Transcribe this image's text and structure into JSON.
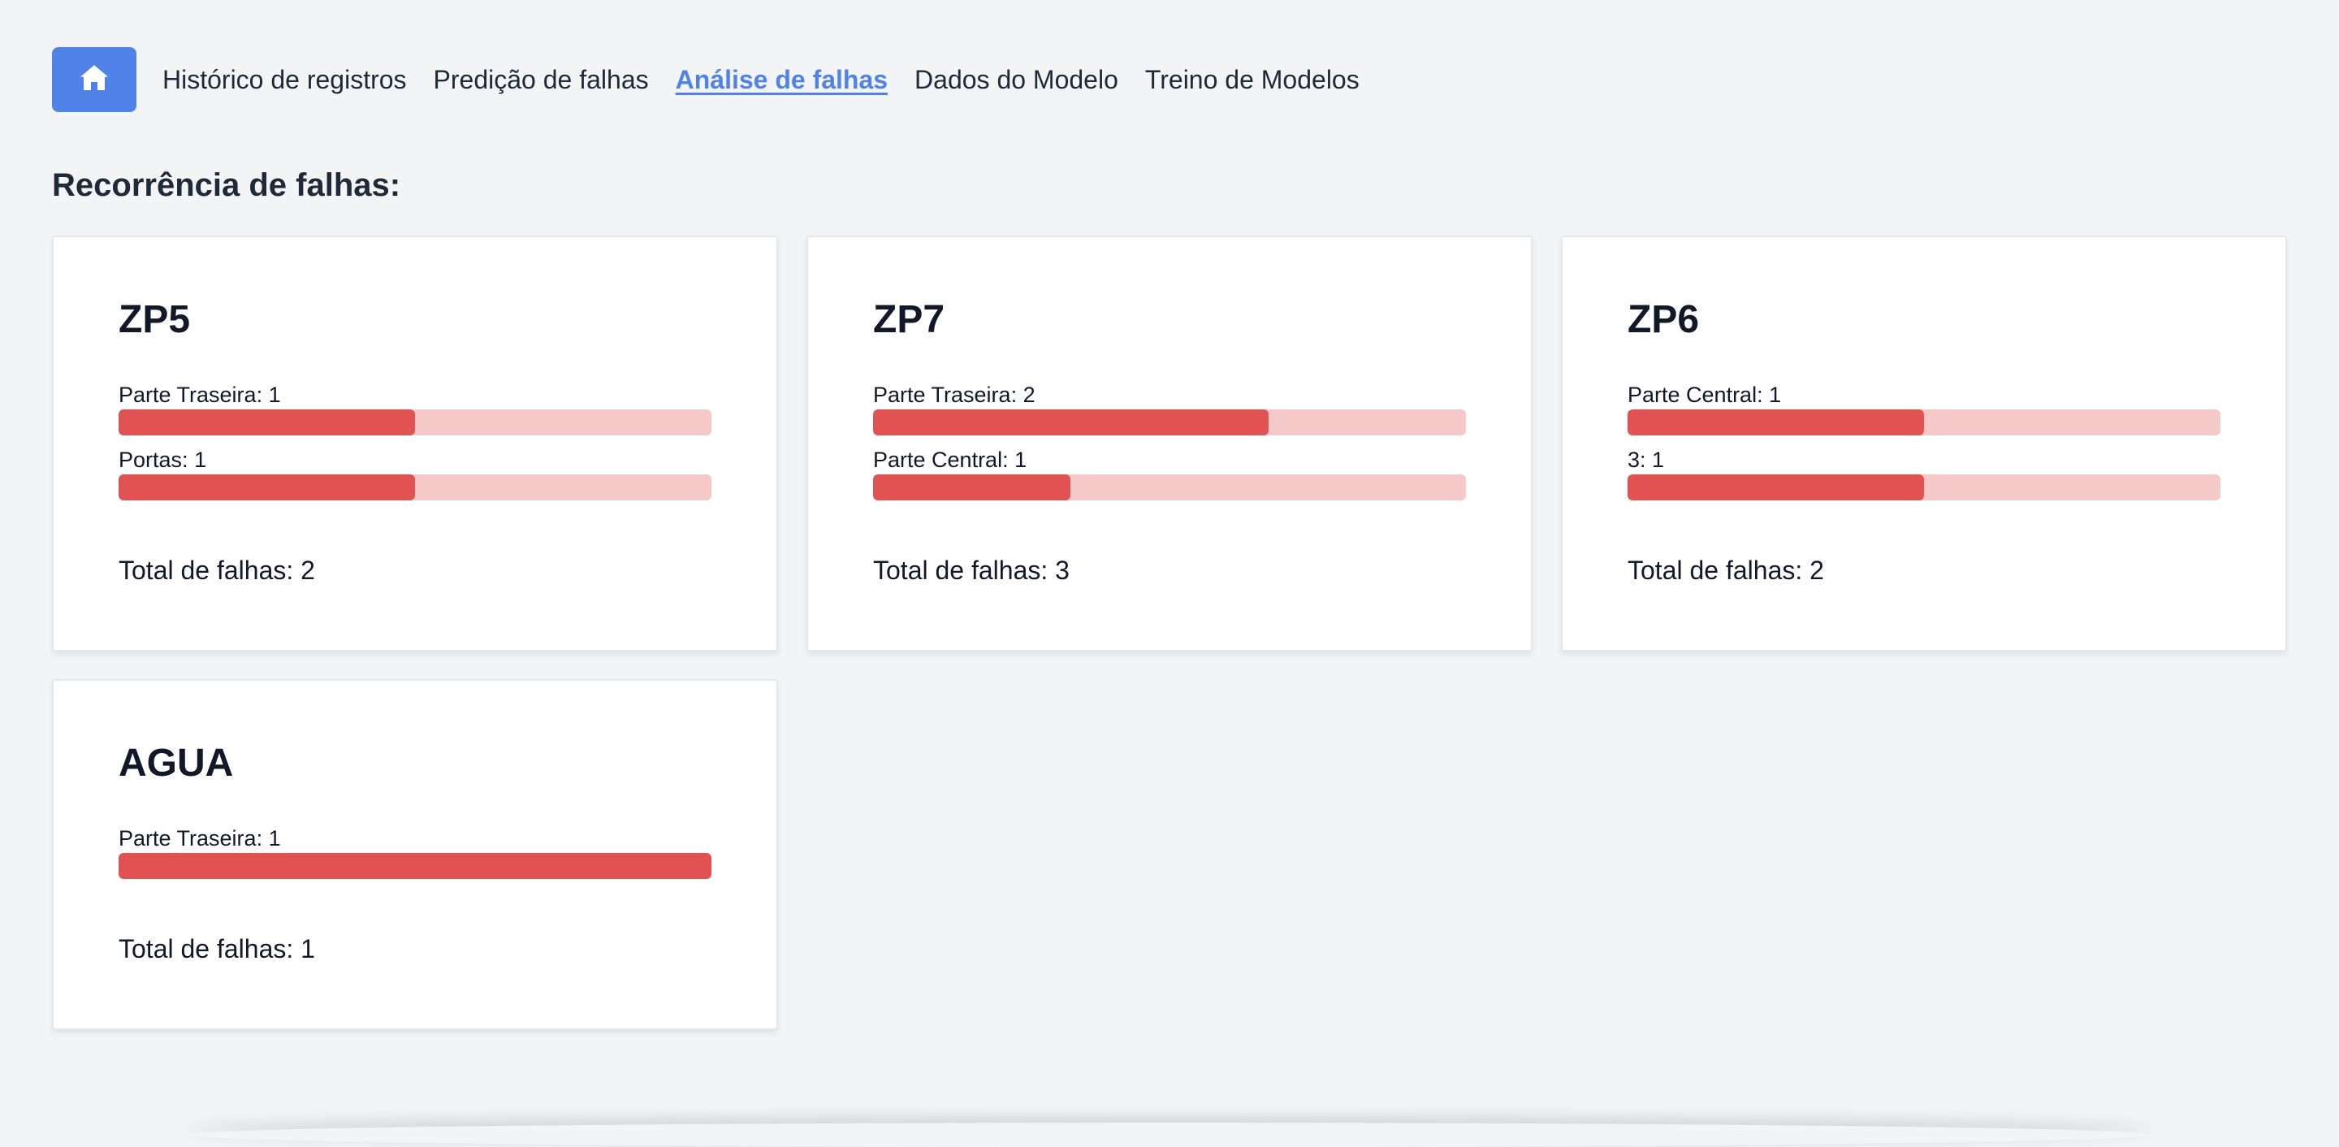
{
  "nav": {
    "home_icon": "home-icon",
    "links": [
      {
        "label": "Histórico de registros",
        "active": false
      },
      {
        "label": "Predição de falhas",
        "active": false
      },
      {
        "label": "Análise de falhas",
        "active": true
      },
      {
        "label": "Dados do Modelo",
        "active": false
      },
      {
        "label": "Treino de Modelos",
        "active": false
      }
    ]
  },
  "page": {
    "title": "Recorrência de falhas:"
  },
  "colors": {
    "accent": "#4f83e8",
    "bar_fill": "#e05352",
    "bar_track": "#f5c9c8",
    "background": "#f3f4f6"
  },
  "cards": [
    {
      "title": "ZP5",
      "faults": [
        {
          "name": "Parte Traseira",
          "count": "1",
          "fraction": 0.5
        },
        {
          "name": "Portas",
          "count": "1",
          "fraction": 0.5
        }
      ],
      "total_label": "Total de falhas: 2"
    },
    {
      "title": "ZP7",
      "faults": [
        {
          "name": "Parte Traseira",
          "count": "2",
          "fraction": 0.6667
        },
        {
          "name": "Parte Central",
          "count": "1",
          "fraction": 0.3333
        }
      ],
      "total_label": "Total de falhas: 3"
    },
    {
      "title": "ZP6",
      "faults": [
        {
          "name": "Parte Central",
          "count": "1",
          "fraction": 0.5
        },
        {
          "name": "3",
          "count": "1",
          "fraction": 0.5
        }
      ],
      "total_label": "Total de falhas: 2"
    },
    {
      "title": "AGUA",
      "faults": [
        {
          "name": "Parte Traseira",
          "count": "1",
          "fraction": 1.0
        }
      ],
      "total_label": "Total de falhas: 1"
    }
  ]
}
